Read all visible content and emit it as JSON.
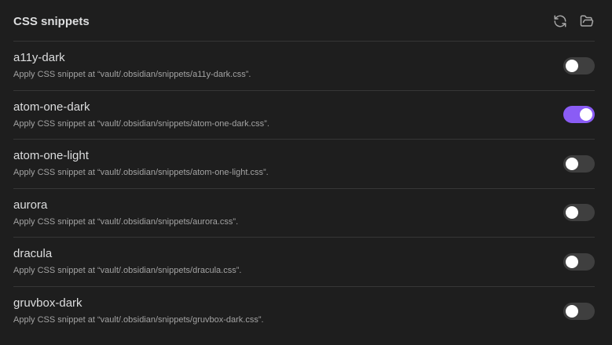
{
  "header": {
    "title": "CSS snippets",
    "icons": [
      "reload-icon",
      "folder-open-icon"
    ]
  },
  "colors": {
    "background": "#1e1e1e",
    "divider": "#363636",
    "toggle_on": "#8a5cf5",
    "toggle_off": "#3f3f3f"
  },
  "snippets": [
    {
      "name": "a11y-dark",
      "description": "Apply CSS snippet at “vault/.obsidian/snippets/a11y-dark.css”.",
      "enabled": false
    },
    {
      "name": "atom-one-dark",
      "description": "Apply CSS snippet at “vault/.obsidian/snippets/atom-one-dark.css”.",
      "enabled": true
    },
    {
      "name": "atom-one-light",
      "description": "Apply CSS snippet at “vault/.obsidian/snippets/atom-one-light.css”.",
      "enabled": false
    },
    {
      "name": "aurora",
      "description": "Apply CSS snippet at “vault/.obsidian/snippets/aurora.css”.",
      "enabled": false
    },
    {
      "name": "dracula",
      "description": "Apply CSS snippet at “vault/.obsidian/snippets/dracula.css”.",
      "enabled": false
    },
    {
      "name": "gruvbox-dark",
      "description": "Apply CSS snippet at “vault/.obsidian/snippets/gruvbox-dark.css”.",
      "enabled": false
    }
  ]
}
